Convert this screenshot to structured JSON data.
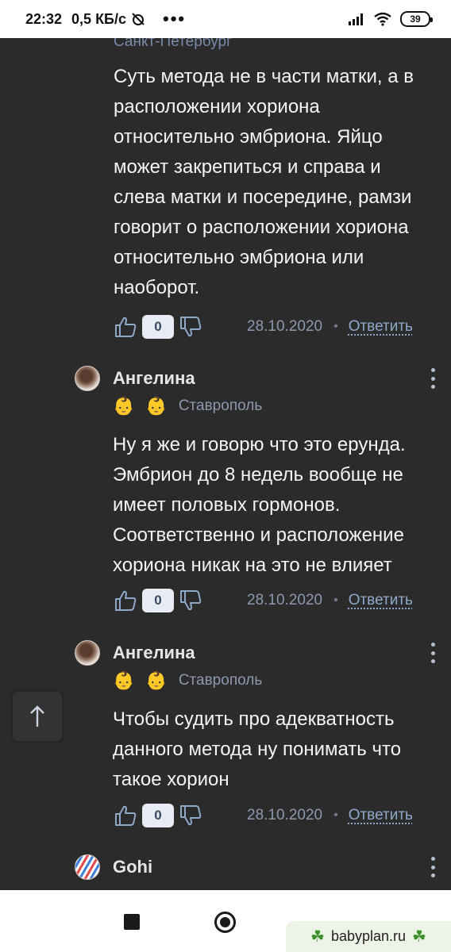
{
  "status_bar": {
    "time": "22:32",
    "speed": "0,5 КБ/с",
    "dots": "•••",
    "battery": "39"
  },
  "top_city": "Санкт-Петербург",
  "first_comment": {
    "text_lines": [
      "Суть метода не в части матки, а в",
      "расположении хориона",
      "относительно эмбриона. Яйцо",
      "может закрепиться и справа и",
      "слева матки и посередине, рамзи",
      "говорит о расположении хориона",
      "относительно эмбриона или",
      "наоборот."
    ],
    "votes": "0",
    "date": "28.10.2020",
    "separator": "•",
    "reply": "Ответить"
  },
  "replies": [
    {
      "author": "Ангелина",
      "badges": [
        "👶",
        "👶"
      ],
      "city": "Ставрополь",
      "text_lines": [
        "Ну я же и говорю что это ерунда.",
        "Эмбрион до 8 недель вообще не",
        "имеет половых гормонов.",
        "Соответственно и расположение",
        "хориона никак на это не влияет"
      ],
      "votes": "0",
      "date": "28.10.2020",
      "separator": "•",
      "reply": "Ответить"
    },
    {
      "author": "Ангелина",
      "badges": [
        "👶",
        "👶"
      ],
      "city": "Ставрополь",
      "text_lines": [
        "Чтобы судить про адекватность",
        "данного метода ну понимать что",
        "такое хорион"
      ],
      "votes": "0",
      "date": "28.10.2020",
      "separator": "•",
      "reply": "Ответить"
    },
    {
      "author": "Gohi"
    }
  ],
  "watermark": {
    "text": "babyplan.ru",
    "clover": "☘"
  },
  "colors": {
    "background": "#2b2b2b",
    "link": "#90a8c8",
    "muted": "#8d98ad"
  },
  "icons": {
    "like": "thumbs-up-icon",
    "dislike": "thumbs-down-icon",
    "more": "kebab-menu-icon",
    "scroll_top": "arrow-up-icon"
  }
}
